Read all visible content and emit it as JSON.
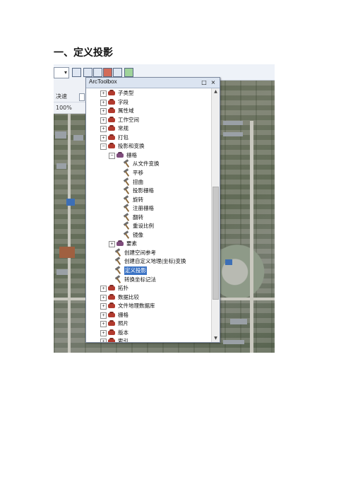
{
  "heading": "一、定义投影",
  "toolbar": {
    "zoom_value": "100%",
    "speed_label": "决速"
  },
  "arctoolbox": {
    "title": "ArcToolbox",
    "pin_button": "□",
    "close_button": "×",
    "items": [
      {
        "label": "子类型",
        "kind": "toolbox",
        "level": 1,
        "expander": "+"
      },
      {
        "label": "字段",
        "kind": "toolbox",
        "level": 1,
        "expander": "+"
      },
      {
        "label": "属性域",
        "kind": "toolbox",
        "level": 1,
        "expander": "+"
      },
      {
        "label": "工作空间",
        "kind": "toolbox",
        "level": 1,
        "expander": "+"
      },
      {
        "label": "常规",
        "kind": "toolbox",
        "level": 1,
        "expander": "+"
      },
      {
        "label": "打包",
        "kind": "toolbox",
        "level": 1,
        "expander": "+"
      },
      {
        "label": "投影和变换",
        "kind": "toolbox",
        "level": 1,
        "expander": "−"
      },
      {
        "label": "栅格",
        "kind": "toolset",
        "level": 2,
        "expander": "−"
      },
      {
        "label": "从文件变换",
        "kind": "tool",
        "level": 3
      },
      {
        "label": "平移",
        "kind": "tool",
        "level": 3
      },
      {
        "label": "扭曲",
        "kind": "tool",
        "level": 3
      },
      {
        "label": "投影栅格",
        "kind": "tool",
        "level": 3
      },
      {
        "label": "旋转",
        "kind": "tool",
        "level": 3
      },
      {
        "label": "注册栅格",
        "kind": "tool",
        "level": 3
      },
      {
        "label": "翻转",
        "kind": "tool",
        "level": 3
      },
      {
        "label": "重设比例",
        "kind": "tool",
        "level": 3
      },
      {
        "label": "镜像",
        "kind": "tool",
        "level": 3
      },
      {
        "label": "要素",
        "kind": "toolset",
        "level": 2,
        "expander": "+"
      },
      {
        "label": "创建空间参考",
        "kind": "tool",
        "level": 2
      },
      {
        "label": "创建自定义地理(坐标)变换",
        "kind": "tool",
        "level": 2
      },
      {
        "label": "定义投影",
        "kind": "tool",
        "level": 2,
        "selected": true
      },
      {
        "label": "转换坐标记法",
        "kind": "tool",
        "level": 2
      },
      {
        "label": "拓扑",
        "kind": "toolbox",
        "level": 1,
        "expander": "+"
      },
      {
        "label": "数据比较",
        "kind": "toolbox",
        "level": 1,
        "expander": "+"
      },
      {
        "label": "文件地理数据库",
        "kind": "toolbox",
        "level": 1,
        "expander": "+"
      },
      {
        "label": "栅格",
        "kind": "toolbox",
        "level": 1,
        "expander": "+"
      },
      {
        "label": "照片",
        "kind": "toolbox",
        "level": 1,
        "expander": "+"
      },
      {
        "label": "版本",
        "kind": "toolbox",
        "level": 1,
        "expander": "+"
      },
      {
        "label": "索引",
        "kind": "toolbox",
        "level": 1,
        "expander": "+"
      }
    ]
  },
  "colors": {
    "selection": "#3b73c5",
    "toolbox_icon": "#b13a2e",
    "toolset_icon": "#7e4c7c"
  }
}
